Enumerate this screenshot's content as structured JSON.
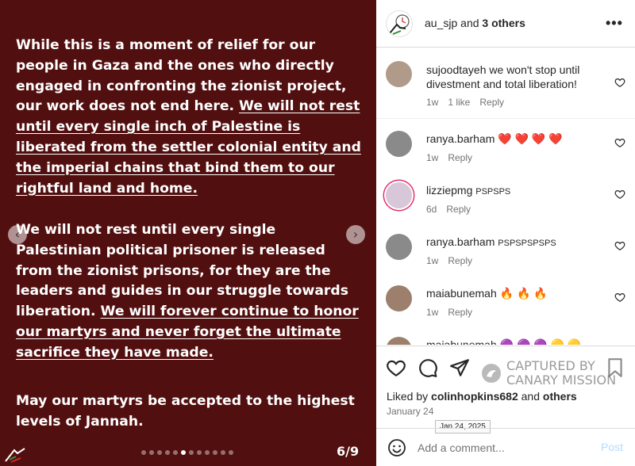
{
  "post": {
    "paragraph1_plain": "While this is a moment of relief for our people in Gaza and the ones who directly engaged in confronting the zionist project, our work does not end here. ",
    "paragraph1_underlined": "We will not rest until every single inch of Palestine is liberated from the settler colonial entity and the imperial chains that bind them to our rightful land and home. ",
    "paragraph2_plain": "We will not rest until every single Palestinian political prisoner is released from the zionist prisons, for they are the leaders and guides in our struggle towards liberation. ",
    "paragraph2_underlined": "We will forever continue to honor our martyrs and never forget the ultimate sacrifice they have made.",
    "paragraph3": "May our martyrs be accepted to the highest levels of Jannah.",
    "page_counter": "6/9",
    "slide_count": 12,
    "active_slide": 6,
    "background_color": "#520f0f"
  },
  "header": {
    "username": "au_sjp",
    "and_text": " and ",
    "others": "3 others",
    "more_icon": "more-options-icon"
  },
  "comments": [
    {
      "user": "sujoodtayeh",
      "text": "we won't stop until divestment and total liberation!",
      "time": "1w",
      "likes": "1 like",
      "reply": "Reply"
    },
    {
      "user": "ranya.barham",
      "text": "❤️ ❤️ ❤️ ❤️",
      "time": "1w",
      "reply": "Reply"
    },
    {
      "user": "lizziepmg",
      "text": "PSPSPS",
      "time": "6d",
      "reply": "Reply"
    },
    {
      "user": "ranya.barham",
      "text": "PSPSPSPSPS",
      "time": "1w",
      "reply": "Reply"
    },
    {
      "user": "maiabunemah",
      "text": "🔥 🔥 🔥",
      "time": "1w",
      "reply": "Reply"
    },
    {
      "user": "maiabunemah",
      "text": "🟣 🟣 🟣 🟡 🟡",
      "time": "",
      "reply": ""
    }
  ],
  "watermark": {
    "line1": "CAPTURED BY",
    "line2": "CANARY MISSION"
  },
  "liked_by": {
    "prefix": "Liked by ",
    "user": "colinhopkins682",
    "and": " and ",
    "others": "others"
  },
  "post_date": "January 24",
  "date_tooltip": "Jan 24, 2025",
  "add_comment": {
    "placeholder": "Add a comment...",
    "post_label": "Post"
  },
  "colors": {
    "accent_disabled": "#b3dbff",
    "muted_text": "#737373",
    "heart_red": "#e3163a"
  }
}
